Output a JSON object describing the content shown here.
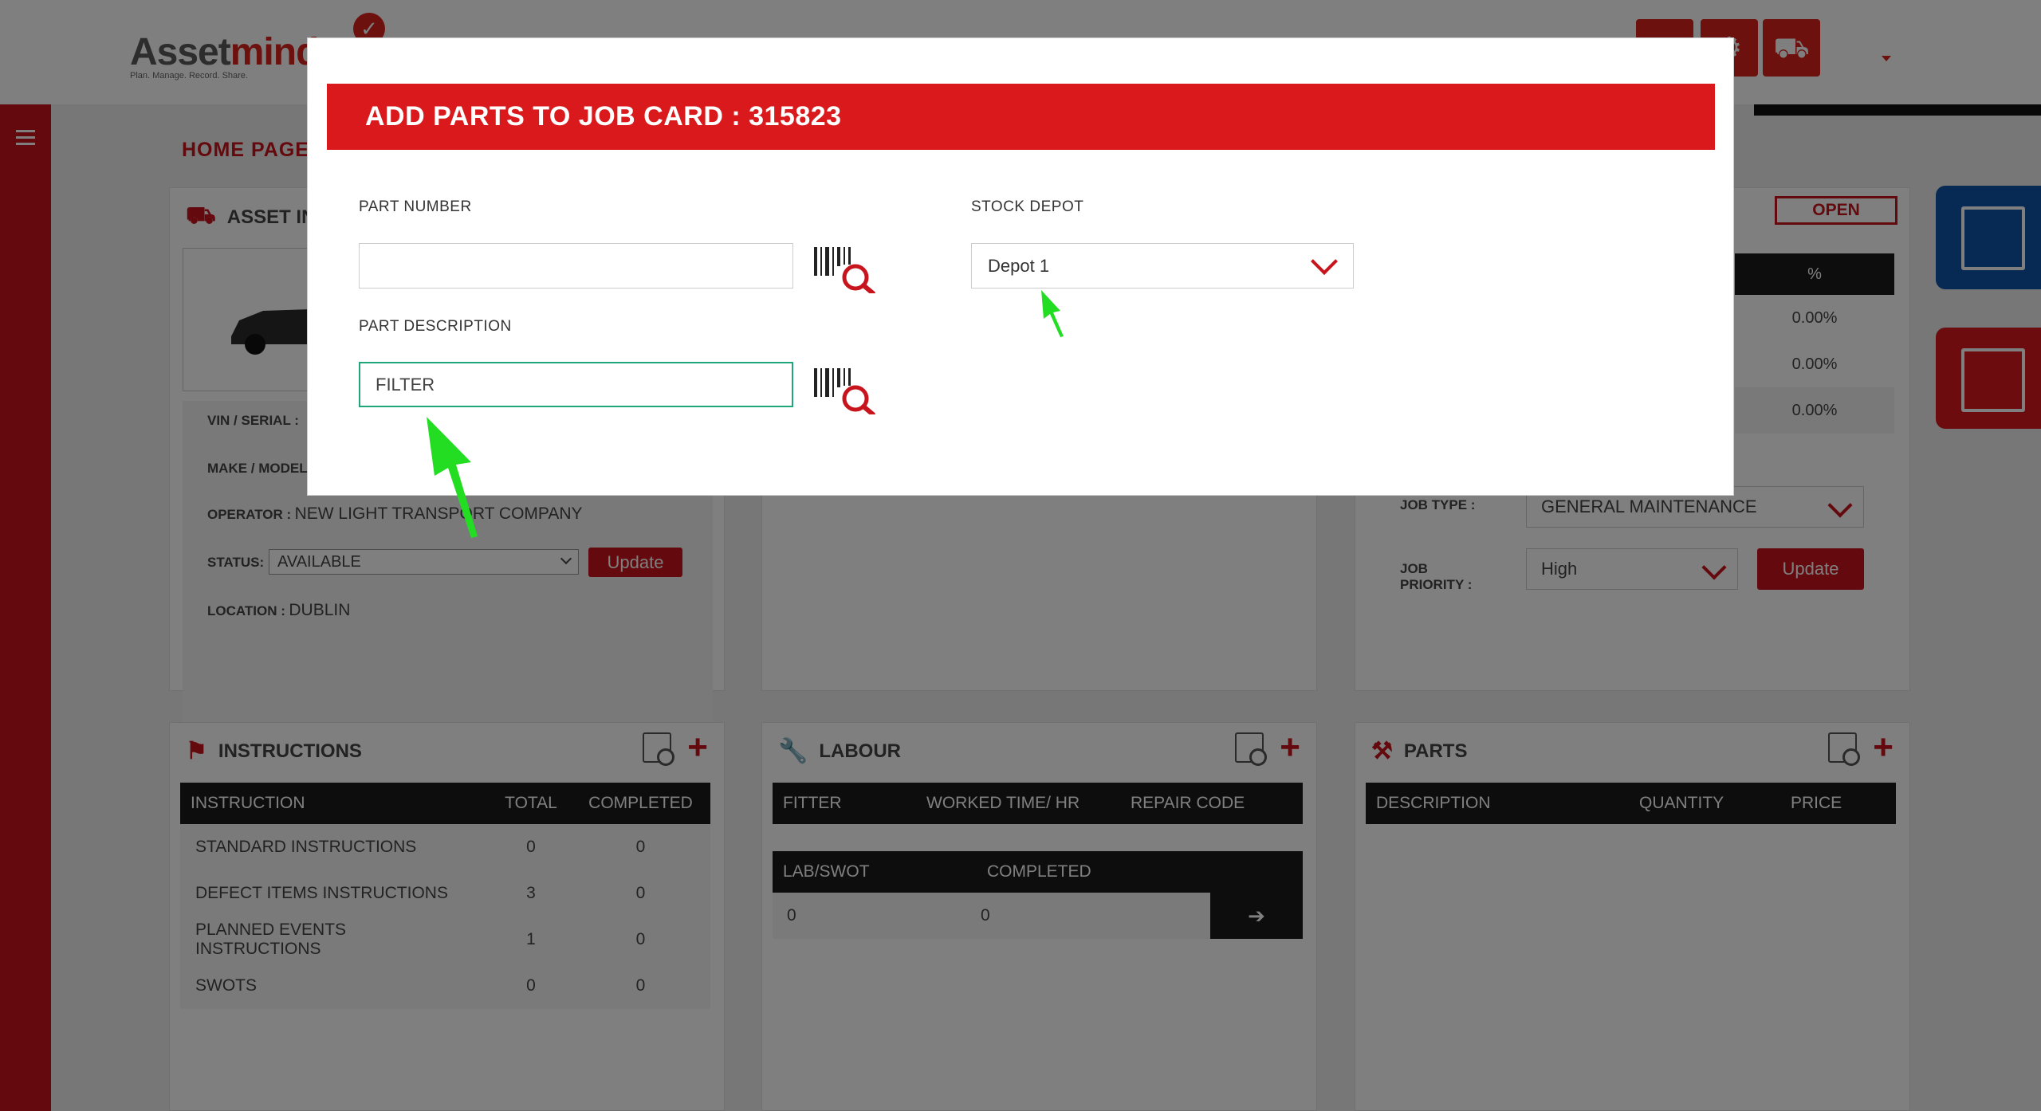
{
  "logo": {
    "brand_part1": "Asset",
    "brand_part2": "mind",
    "tagline": "Plan. Manage. Record. Share."
  },
  "page": {
    "title": "HOME PAGE"
  },
  "asset_info": {
    "heading": "ASSET INFO",
    "vin_label": "VIN / SERIAL :",
    "make_label": "MAKE / MODEL :",
    "operator_label": "OPERATOR :",
    "operator_value": "NEW LIGHT TRANSPORT COMPANY",
    "status_label": "STATUS:",
    "status_value": "AVAILABLE",
    "update_label": "Update",
    "location_label": "LOCATION :",
    "location_value": "DUBLIN"
  },
  "job_info": {
    "status_badge": "OPEN",
    "pct_header": "%",
    "pct_values": [
      "0.00%",
      "0.00%",
      "0.00%"
    ],
    "job_type_label": "JOB TYPE :",
    "job_type_value": "GENERAL MAINTENANCE",
    "job_priority_label": "JOB PRIORITY :",
    "job_priority_value": "High",
    "update_label": "Update"
  },
  "instructions": {
    "heading": "INSTRUCTIONS",
    "columns": [
      "INSTRUCTION",
      "TOTAL",
      "COMPLETED"
    ],
    "rows": [
      {
        "name": "STANDARD INSTRUCTIONS",
        "total": "0",
        "completed": "0"
      },
      {
        "name": "DEFECT ITEMS INSTRUCTIONS",
        "total": "3",
        "completed": "0"
      },
      {
        "name": "PLANNED EVENTS INSTRUCTIONS",
        "total": "1",
        "completed": "0"
      },
      {
        "name": "SWOTS",
        "total": "0",
        "completed": "0"
      }
    ]
  },
  "labour": {
    "heading": "LABOUR",
    "columns": [
      "FITTER",
      "WORKED TIME/ HR",
      "REPAIR CODE"
    ],
    "swot_columns": [
      "LAB/SWOT",
      "COMPLETED"
    ],
    "swot_row": {
      "lab": "0",
      "completed": "0"
    }
  },
  "parts": {
    "heading": "PARTS",
    "columns": [
      "DESCRIPTION",
      "QUANTITY",
      "PRICE"
    ]
  },
  "modal": {
    "title": "ADD PARTS TO JOB CARD : 315823",
    "part_number_label": "PART NUMBER",
    "part_number_value": "",
    "part_description_label": "PART DESCRIPTION",
    "part_description_value": "FILTER",
    "stock_depot_label": "STOCK DEPOT",
    "stock_depot_value": "Depot 1"
  },
  "colors": {
    "brand_red": "#d9191c",
    "dark_header": "#1a1a1a",
    "focus_green": "#1fa67a",
    "annotation_green": "#22dd22",
    "side_blue": "#0c54a6"
  },
  "icons": [
    "check-icon",
    "home-icon",
    "gear-icon",
    "truck-info-icon",
    "hamburger-icon",
    "truck-icon",
    "flag-icon",
    "wrench-icon",
    "tools-icon",
    "document-search-icon",
    "plus-icon",
    "barcode-search-icon",
    "chevron-down-icon",
    "arrow-right-icon"
  ]
}
